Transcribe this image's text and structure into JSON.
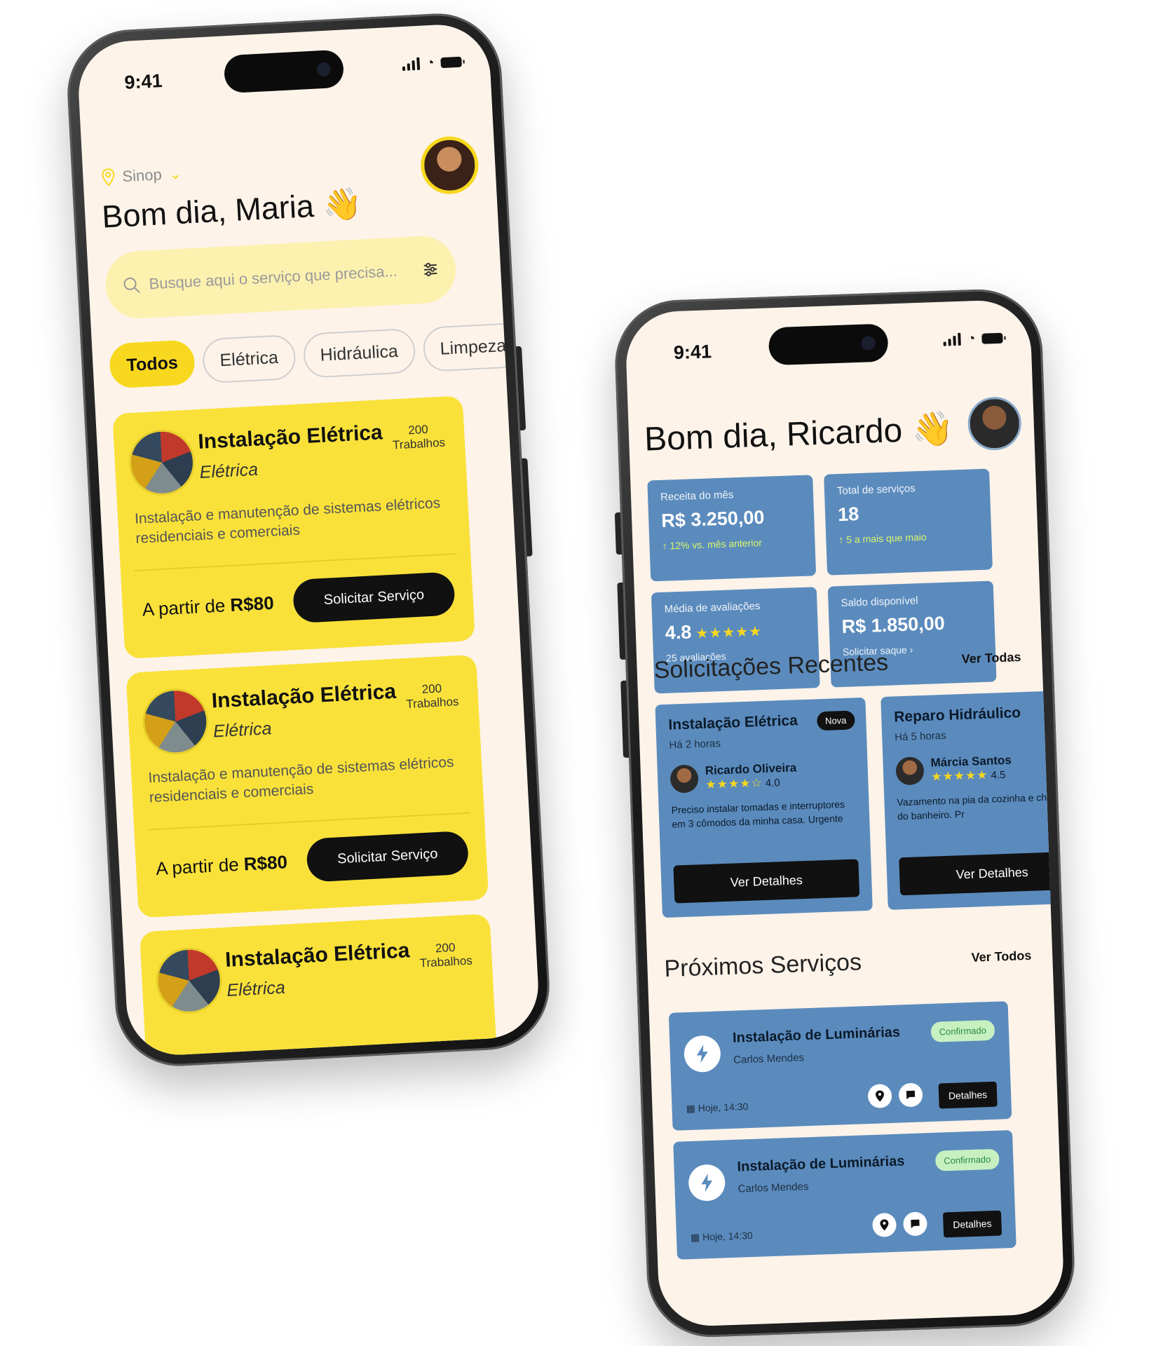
{
  "phone1": {
    "status": {
      "time": "9:41"
    },
    "location": "Sinop",
    "greeting": "Bom dia, Maria",
    "greeting_emoji": "👋",
    "search": {
      "placeholder": "Busque aqui o serviço que precisa..."
    },
    "chips": [
      "Todos",
      "Elétrica",
      "Hidráulica",
      "Limpeza"
    ],
    "services": [
      {
        "title": "Instalação Elétrica",
        "category": "Elétrica",
        "count": "200",
        "count_label": "Trabalhos",
        "description": "Instalação e manutenção de sistemas elétricos residenciais e comerciais",
        "price_prefix": "A partir de",
        "price": "R$80",
        "button": "Solicitar Serviço"
      },
      {
        "title": "Instalação Elétrica",
        "category": "Elétrica",
        "count": "200",
        "count_label": "Trabalhos",
        "description": "Instalação e manutenção de sistemas elétricos residenciais e comerciais",
        "price_prefix": "A partir de",
        "price": "R$80",
        "button": "Solicitar Serviço"
      },
      {
        "title": "Instalação Elétrica",
        "category": "Elétrica",
        "count": "200",
        "count_label": "Trabalhos"
      }
    ],
    "colors": {
      "accent": "#f9e13a",
      "background": "#fdf3e9"
    }
  },
  "phone2": {
    "status": {
      "time": "9:41"
    },
    "greeting": "Bom dia, Ricardo",
    "greeting_emoji": "👋",
    "stats": [
      {
        "label": "Receita do mês",
        "value": "R$ 3.250,00",
        "sub": "↑ 12% vs. mês anterior"
      },
      {
        "label": "Total de serviços",
        "value": "18",
        "sub": "↑ 5 a mais que maio"
      },
      {
        "label": "Média de avaliações",
        "value": "4.8",
        "stars": "★★★★★",
        "sub": "25 avaliações"
      },
      {
        "label": "Saldo disponível",
        "value": "R$ 1.850,00",
        "sub": "Solicitar saque ›"
      }
    ],
    "recent": {
      "title": "Solicitações Recentes",
      "link": "Ver Todas",
      "items": [
        {
          "title": "Instalação Elétrica",
          "ago": "Há 2 horas",
          "badge": "Nova",
          "name": "Ricardo Oliveira",
          "stars": "★★★★☆",
          "rating": "4.0",
          "message": "Preciso instalar tomadas e interruptores em 3 cômodos da minha casa. Urgente",
          "button": "Ver Detalhes"
        },
        {
          "title": "Reparo Hidráulico",
          "ago": "Há 5 horas",
          "name": "Márcia Santos",
          "stars": "★★★★★",
          "rating": "4.5",
          "message": "Vazamento na pia da cozinha e chuveiro do banheiro. Pr",
          "button": "Ver Detalhes"
        }
      ]
    },
    "upcoming": {
      "title": "Próximos Serviços",
      "link": "Ver Todos",
      "items": [
        {
          "title": "Instalação de Luminárias",
          "name": "Carlos Mendes",
          "date": "Hoje, 14:30",
          "status": "Confirmado",
          "button": "Detalhes"
        },
        {
          "title": "Instalação de Luminárias",
          "name": "Carlos Mendes",
          "date": "Hoje, 14:30",
          "status": "Confirmado",
          "button": "Detalhes"
        }
      ]
    },
    "colors": {
      "card": "#5b8bbd",
      "confirmed": "#c6f0c0"
    }
  }
}
